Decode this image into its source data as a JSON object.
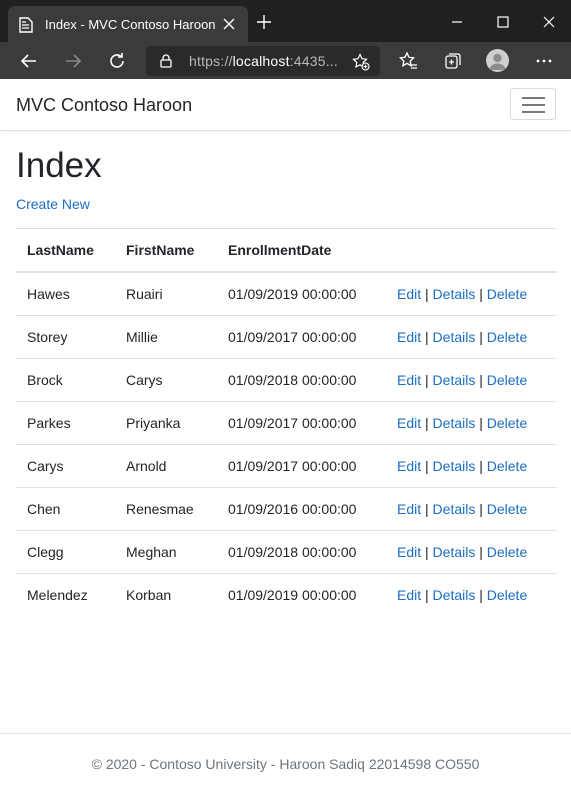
{
  "browser": {
    "tab_title": "Index - MVC Contoso Haroon",
    "url_prefix": "https://",
    "url_host": "localhost",
    "url_rest": ":4435..."
  },
  "navbar": {
    "brand": "MVC Contoso Haroon"
  },
  "page": {
    "title": "Index",
    "create_link": "Create New"
  },
  "table": {
    "headers": [
      "LastName",
      "FirstName",
      "EnrollmentDate",
      ""
    ],
    "rows": [
      {
        "last": "Hawes",
        "first": "Ruairi",
        "date": "01/09/2019 00:00:00"
      },
      {
        "last": "Storey",
        "first": "Millie",
        "date": "01/09/2017 00:00:00"
      },
      {
        "last": "Brock",
        "first": "Carys",
        "date": "01/09/2018 00:00:00"
      },
      {
        "last": "Parkes",
        "first": "Priyanka",
        "date": "01/09/2017 00:00:00"
      },
      {
        "last": "Carys",
        "first": "Arnold",
        "date": "01/09/2017 00:00:00"
      },
      {
        "last": "Chen",
        "first": "Renesmae",
        "date": "01/09/2016 00:00:00"
      },
      {
        "last": "Clegg",
        "first": "Meghan",
        "date": "01/09/2018 00:00:00"
      },
      {
        "last": "Melendez",
        "first": "Korban",
        "date": "01/09/2019 00:00:00"
      }
    ],
    "actions": {
      "edit": "Edit",
      "details": "Details",
      "delete": "Delete",
      "separator": "|"
    }
  },
  "footer": {
    "text": "© 2020 - Contoso University - Haroon Sadiq 22014598 CO550"
  },
  "colors": {
    "link": "#1b6ec2",
    "chrome_dark": "#202020",
    "chrome_toolbar": "#3b3b3b"
  },
  "icons": [
    "page-icon",
    "close-icon",
    "plus-icon",
    "minimize-icon",
    "maximize-icon",
    "back-icon",
    "forward-icon",
    "refresh-icon",
    "lock-icon",
    "favorite-add-icon",
    "favorites-icon",
    "collections-icon",
    "profile-icon",
    "more-icon",
    "hamburger-icon"
  ]
}
